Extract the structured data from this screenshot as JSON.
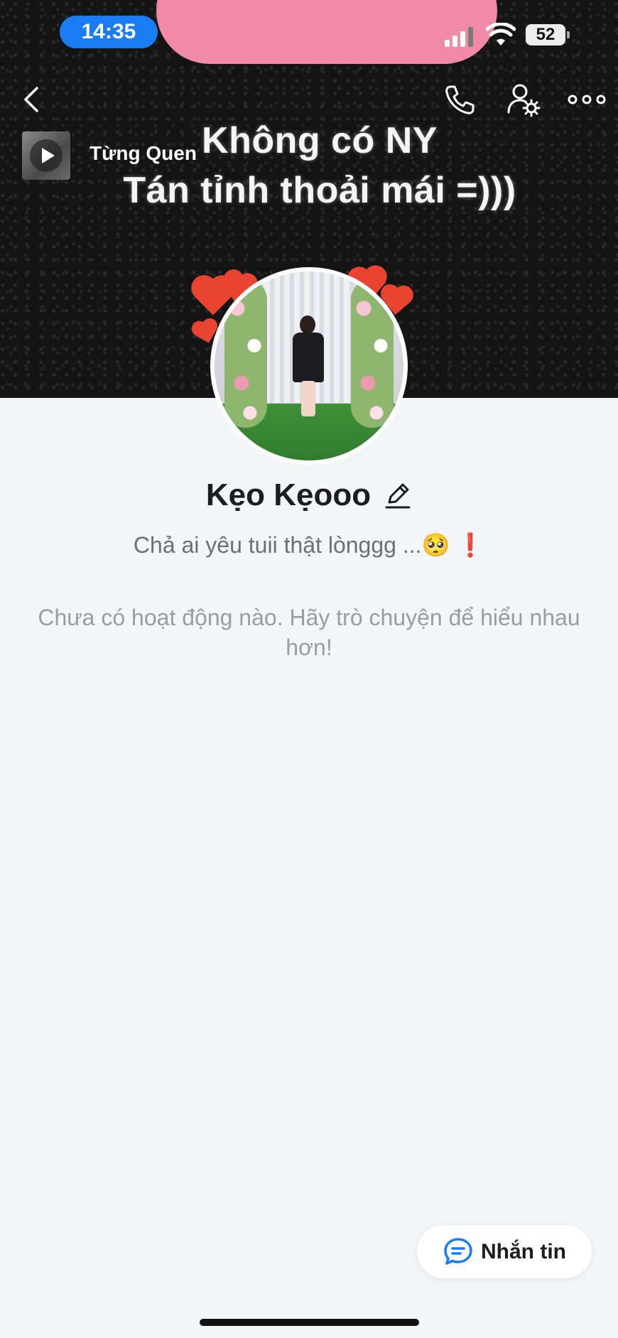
{
  "status_bar": {
    "time": "14:35",
    "battery": "52"
  },
  "cover": {
    "line1": "Không có NY",
    "line2": "Tán tỉnh thoải mái =)))"
  },
  "music": {
    "title": "Từng Quen"
  },
  "profile": {
    "name": "Kẹo Kẹooo",
    "bio": "Chả ai yêu tuii thật lònggg ...🥺 ❗"
  },
  "activity": {
    "empty_message": "Chưa có hoạt động nào. Hãy trò chuyện để hiểu nhau hơn!"
  },
  "actions": {
    "message_label": "Nhắn tin"
  },
  "icons": {
    "back": "back-chevron-icon",
    "phone": "phone-icon",
    "user_settings": "user-settings-icon",
    "more": "more-icon",
    "edit": "edit-icon",
    "chat": "chat-icon",
    "play": "play-icon"
  },
  "colors": {
    "accent": "#1a7cf5",
    "page_background": "#f4f5f7",
    "cover_pink": "#f18aa7",
    "heart_red": "#e8442f"
  }
}
